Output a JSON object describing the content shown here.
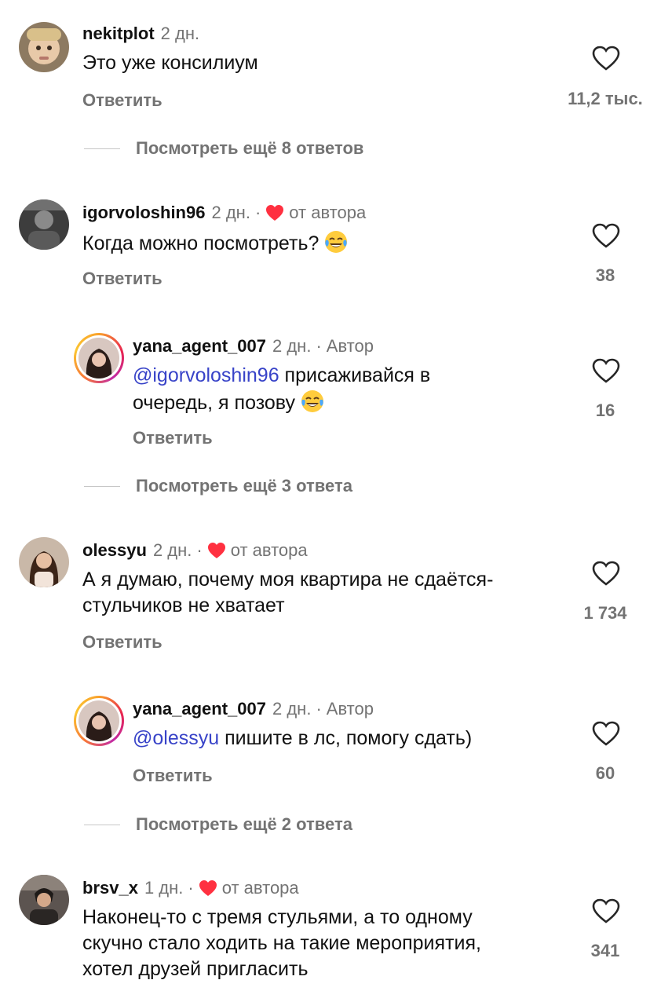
{
  "comments": [
    {
      "user": "nekitplot",
      "time": "2 дн.",
      "author_tag": "",
      "text": "Это уже консилиум",
      "reply": "Ответить",
      "likes": "11,2 тыс."
    },
    {
      "more": "Посмотреть ещё 8 ответов"
    },
    {
      "user": "igorvoloshin96",
      "time": "2 дн.",
      "author_tag": "от автора",
      "text": "Когда можно посмотреть?",
      "reply": "Ответить",
      "likes": "38"
    },
    {
      "user": "yana_agent_007",
      "time": "2 дн.",
      "author_tag": "Автор",
      "mention": "@igorvoloshin96",
      "text_line1": " присаживайся в",
      "text_line2": "очередь, я позову",
      "reply": "Ответить",
      "likes": "16"
    },
    {
      "more": "Посмотреть ещё 3 ответа"
    },
    {
      "user": "olessyu",
      "time": "2 дн.",
      "author_tag": "от автора",
      "text_line1": "А я думаю, почему моя квартира не сдаётся-",
      "text_line2": "стульчиков не хватает",
      "reply": "Ответить",
      "likes": "1 734"
    },
    {
      "user": "yana_agent_007",
      "time": "2 дн.",
      "author_tag": "Автор",
      "mention": "@olessyu",
      "text": " пишите в лс, помогу сдать)",
      "reply": "Ответить",
      "likes": "60"
    },
    {
      "more": "Посмотреть ещё 2 ответа"
    },
    {
      "user": "brsv_x",
      "time": "1 дн.",
      "author_tag": "от автора",
      "text_line1": "Наконец-то с тремя стульями, а то одному",
      "text_line2": "скучно стало ходить на такие мероприятия,",
      "text_line3": "хотел друзей пригласить",
      "likes": "341"
    }
  ],
  "dot": "·",
  "colors": {
    "heart_red": "#ff3040",
    "secondary": "#737373",
    "mention": "#3843c8"
  },
  "icons": {
    "like": "heart-outline-icon",
    "author_like": "heart-filled-icon",
    "laugh": "tears-of-joy-emoji"
  }
}
